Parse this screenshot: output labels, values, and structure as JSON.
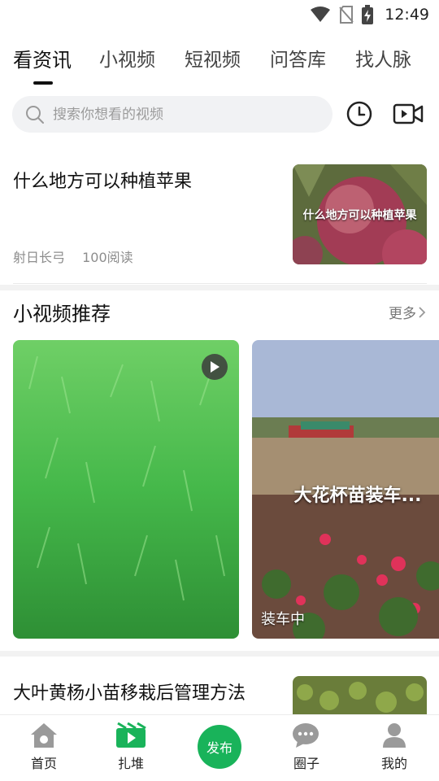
{
  "status_bar": {
    "time": "12:49"
  },
  "tabs": [
    {
      "label": "看资讯",
      "active": true
    },
    {
      "label": "小视频",
      "active": false
    },
    {
      "label": "短视频",
      "active": false
    },
    {
      "label": "问答库",
      "active": false
    },
    {
      "label": "找人脉",
      "active": false
    }
  ],
  "search": {
    "placeholder": "搜索你想看的视频"
  },
  "articles": [
    {
      "title": "什么地方可以种植苹果",
      "author": "射日长弓",
      "reads": "100阅读",
      "thumb_caption": "什么地方可以种植苹果"
    },
    {
      "title": "大叶黄杨小苗移栽后管理方法"
    }
  ],
  "section": {
    "title": "小视频推荐",
    "more_label": "更多"
  },
  "videos": [
    {
      "overlay_title": "",
      "label": ""
    },
    {
      "overlay_title": "大花杯苗装车...",
      "label": "装车中"
    }
  ],
  "bottom_nav": [
    {
      "label": "首页"
    },
    {
      "label": "扎堆"
    },
    {
      "label": "发布"
    },
    {
      "label": "圈子"
    },
    {
      "label": "我的"
    }
  ],
  "colors": {
    "accent": "#19b35a",
    "text": "#111111",
    "muted": "#8d8d8d"
  }
}
